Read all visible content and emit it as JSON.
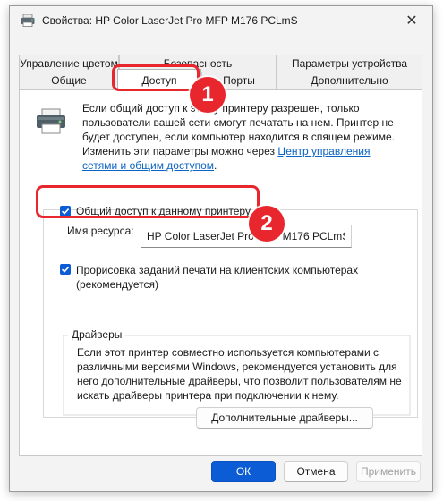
{
  "window": {
    "title": "Свойства: HP Color LaserJet Pro MFP M176 PCLmS",
    "close_glyph": "✕"
  },
  "tabs": {
    "back_row": [
      "Управление цветом",
      "Безопасность",
      "Параметры устройства"
    ],
    "front_row": [
      "Общие",
      "Доступ",
      "Порты",
      "Дополнительно"
    ],
    "active": "Доступ"
  },
  "intro": {
    "line1": "Если общий доступ к этому принтеру разрешен, только",
    "line2": "пользователи вашей сети смогут печатать на нем. Принтер не",
    "line3": "будет доступен, если компьютер находится в спящем режиме.",
    "line4_prefix": "Изменить эти параметры можно через ",
    "link_part1": "Центр управления",
    "link_part2": "сетями и общим доступом",
    "line5_suffix": "."
  },
  "share": {
    "label": "Общий доступ к данному принтеру",
    "checked": true
  },
  "resource": {
    "label": "Имя ресурса:",
    "value": "HP Color LaserJet Pro MFP M176 PCLmS"
  },
  "render": {
    "label": "Прорисовка заданий печати на клиентских компьютерах (рекомендуется)",
    "checked": true
  },
  "drivers": {
    "title": "Драйверы",
    "text": "Если этот принтер совместно используется компьютерами с различными версиями Windows, рекомендуется установить для него дополнительные драйверы, что позволит пользователям не искать драйверы принтера при подключении к нему.",
    "button": "Дополнительные драйверы..."
  },
  "buttons": {
    "ok": "ОК",
    "cancel": "Отмена",
    "apply": "Применить"
  },
  "annotations": {
    "marker1": "1",
    "marker2": "2",
    "color": "#e8262e"
  },
  "colors": {
    "accent": "#0b5cd5",
    "link": "#0b63c4"
  }
}
